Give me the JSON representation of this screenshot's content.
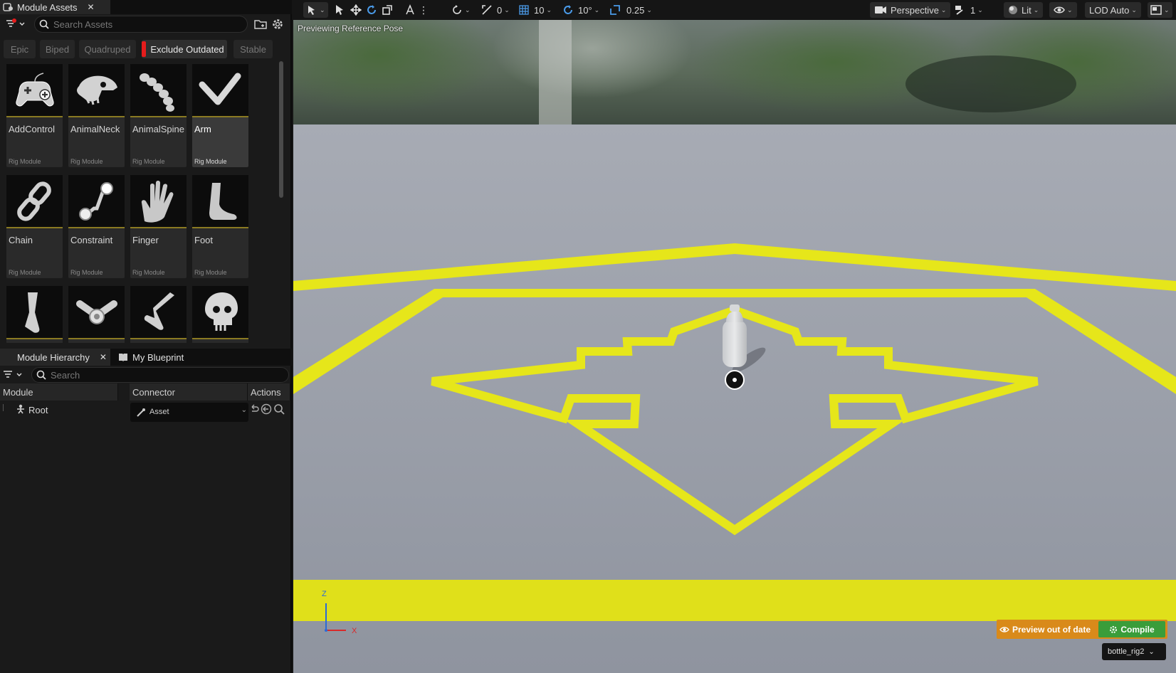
{
  "module_assets": {
    "tab_title": "Module Assets",
    "search_placeholder": "Search Assets",
    "filters": [
      {
        "label": "Epic",
        "active": false
      },
      {
        "label": "Biped",
        "active": false
      },
      {
        "label": "Quadruped",
        "active": false
      },
      {
        "label": "Exclude Outdated",
        "active": true
      },
      {
        "label": "Stable",
        "active": false
      }
    ],
    "assets": [
      {
        "name": "AddControl",
        "type": "Rig Module",
        "icon": "gamepad-icon"
      },
      {
        "name": "AnimalNeck",
        "type": "Rig Module",
        "icon": "animal-skull-icon"
      },
      {
        "name": "AnimalSpine",
        "type": "Rig Module",
        "icon": "spine-icon"
      },
      {
        "name": "Arm",
        "type": "Rig Module",
        "icon": "arm-icon",
        "selected": true
      },
      {
        "name": "Chain",
        "type": "Rig Module",
        "icon": "chain-icon"
      },
      {
        "name": "Constraint",
        "type": "Rig Module",
        "icon": "constraint-icon"
      },
      {
        "name": "Finger",
        "type": "Rig Module",
        "icon": "hand-icon"
      },
      {
        "name": "Foot",
        "type": "Rig Module",
        "icon": "foot-icon"
      },
      {
        "name": "",
        "type": "",
        "icon": "leg-icon"
      },
      {
        "name": "",
        "type": "",
        "icon": "bone-joint-icon"
      },
      {
        "name": "",
        "type": "",
        "icon": "knee-icon"
      },
      {
        "name": "",
        "type": "",
        "icon": "skull-icon"
      }
    ]
  },
  "module_hierarchy": {
    "tab_title": "Module Hierarchy",
    "blueprint_tab": "My Blueprint",
    "search_placeholder": "Search",
    "columns": [
      "Module",
      "Connector",
      "Actions"
    ],
    "rows": [
      {
        "module": "Root",
        "connector": "Asset"
      }
    ]
  },
  "viewport": {
    "toolbar": {
      "translate_snap": "0",
      "grid_snap": "10",
      "rotate_snap": "10°",
      "scale_snap": "0.25",
      "view_mode": "Perspective",
      "camera_speed": "1",
      "lighting": "Lit",
      "lod": "LOD Auto"
    },
    "overlay_text": "Previewing Reference Pose",
    "axis_z": "Z",
    "axis_x": "X",
    "preview_status": "Preview out of date",
    "compile_label": "Compile",
    "rig_name": "bottle_rig2"
  },
  "colors": {
    "accent_yellow": "#e6e61a",
    "floor": "#9aa0ab",
    "compile_green": "#3a9d3a",
    "warning_orange": "#d98a1a",
    "filter_red": "#e51c1c"
  }
}
